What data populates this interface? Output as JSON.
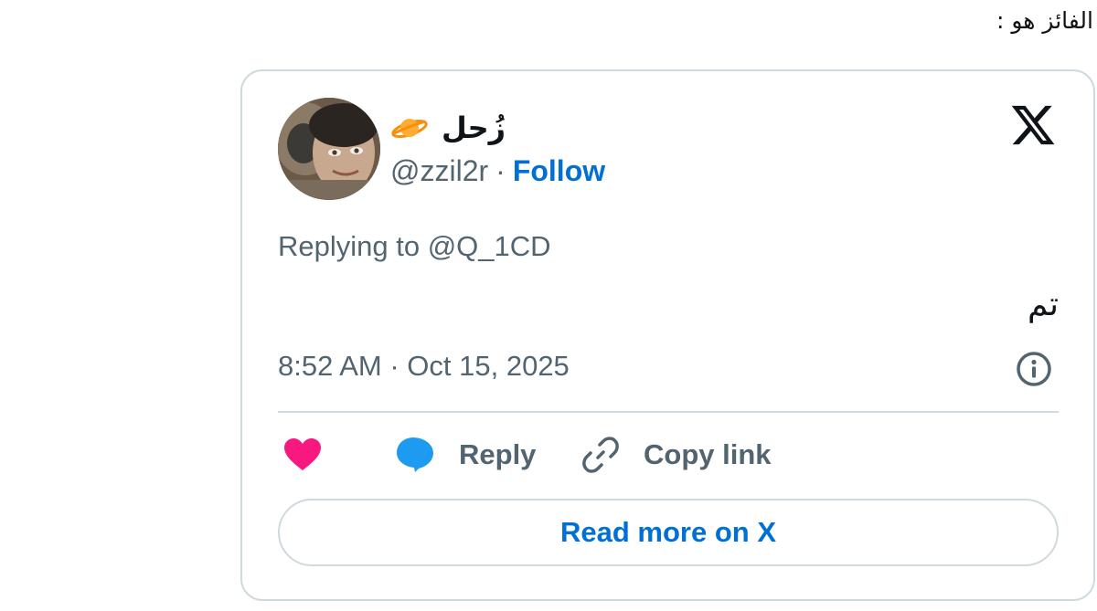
{
  "intro_text": "الفائز هو :",
  "tweet": {
    "author": {
      "display_name": "زُحل",
      "name_emoji_icon": "ringed-planet-icon",
      "handle": "@zzil2r",
      "separator": "·",
      "follow_label": "Follow"
    },
    "platform_logo": "x-logo",
    "replying_to": "Replying to @Q_1CD",
    "text": "تم",
    "timestamp": "8:52 AM · Oct 15, 2025",
    "info_icon": "info-icon",
    "actions": {
      "like_icon": "heart-icon",
      "reply_icon": "speech-bubble-icon",
      "reply_label": "Reply",
      "copy_icon": "link-icon",
      "copy_label": "Copy link"
    },
    "read_more_label": "Read more on X"
  },
  "colors": {
    "accent_blue": "#006fd6",
    "secondary_text": "#536471",
    "border": "#cfd9de",
    "heart": "#f91880",
    "reply_bubble": "#1d9bf0"
  }
}
